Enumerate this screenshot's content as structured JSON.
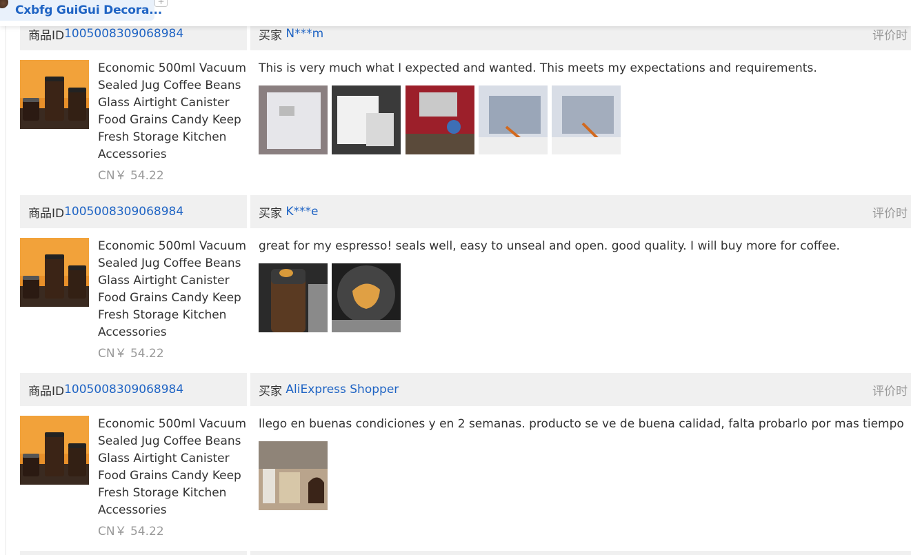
{
  "tab": {
    "title": "Cxbfg GuiGui Decora...",
    "add_label": "+"
  },
  "labels": {
    "product_id": "商品ID",
    "buyer": "买家",
    "review_time": "评价时"
  },
  "reviews": [
    {
      "product_id": "1005008309068984",
      "buyer": "N***m",
      "product_name": "Economic 500ml Vacuum Sealed Jug Coffee Beans Glass Airtight Canister Food Grains Candy Keep Fresh Storage Kitchen Accessories",
      "price": "CN￥ 54.22",
      "comment": "This is very much what I expected and wanted. This meets my expectations and requirements.",
      "photos": [
        "white-package-photo",
        "packaging-foam-photo",
        "red-tablecloth-photo",
        "scissors-bag-photo",
        "scissors-bag-photo-2"
      ]
    },
    {
      "product_id": "1005008309068984",
      "buyer": "K***e",
      "product_name": "Economic 500ml Vacuum Sealed Jug Coffee Beans Glass Airtight Canister Food Grains Candy Keep Fresh Storage Kitchen Accessories",
      "price": "CN￥ 54.22",
      "comment": "great for my espresso! seals well, easy to unseal and open. good quality. I will buy more for coffee.",
      "photos": [
        "coffee-jar-side-photo",
        "coffee-jar-lid-photo"
      ]
    },
    {
      "product_id": "1005008309068984",
      "buyer": "AliExpress Shopper",
      "product_name": "Economic 500ml Vacuum Sealed Jug Coffee Beans Glass Airtight Canister Food Grains Candy Keep Fresh Storage Kitchen Accessories",
      "price": "CN￥ 54.22",
      "comment": "llego en buenas condiciones y en 2 semanas. producto se ve de buena calidad, falta probarlo por mas tiempo",
      "photos": [
        "kitchen-counter-photo"
      ]
    }
  ]
}
